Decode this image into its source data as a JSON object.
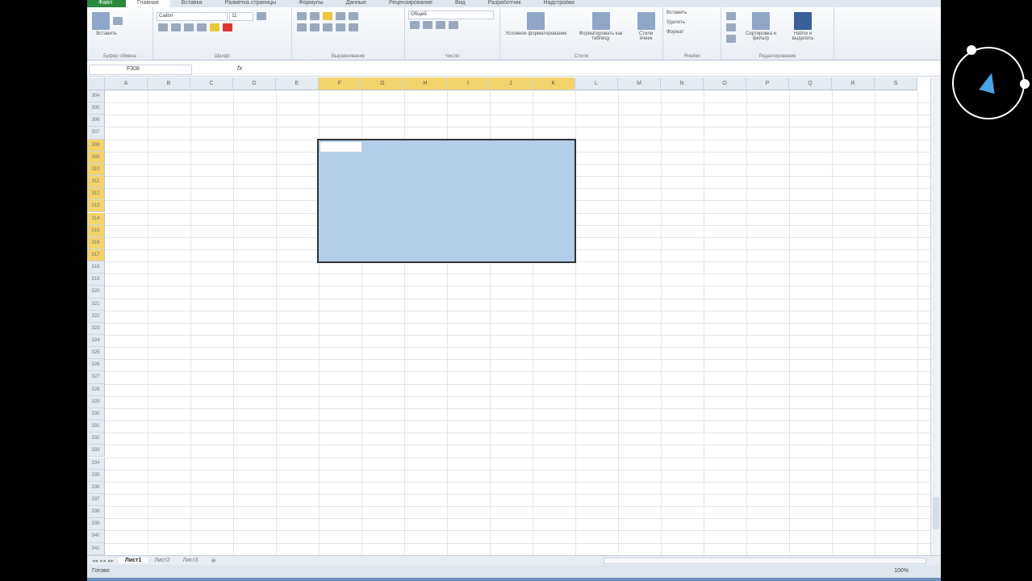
{
  "ribbon_tabs": [
    "Файл",
    "Главная",
    "Вставка",
    "Разметка страницы",
    "Формулы",
    "Данные",
    "Рецензирование",
    "Вид",
    "Разработчик",
    "Надстройки"
  ],
  "ribbon": {
    "clipboard": {
      "paste": "Вставить",
      "label": "Буфер обмена"
    },
    "font": {
      "name": "Calibri",
      "size": "11",
      "label": "Шрифт"
    },
    "alignment": {
      "label": "Выравнивание"
    },
    "number": {
      "format": "Общий",
      "label": "Число"
    },
    "styles": {
      "conditional": "Условное форматирование",
      "as_table": "Форматировать как таблицу",
      "cell_styles": "Стили ячеек",
      "label": "Стили"
    },
    "cells": {
      "insert": "Вставить",
      "delete": "Удалить",
      "format": "Формат",
      "label": "Ячейки"
    },
    "editing": {
      "sort": "Сортировка и фильтр",
      "find": "Найти и выделить",
      "label": "Редактирование"
    }
  },
  "formula_bar": {
    "name_box": "F308",
    "fx": "fx",
    "value": ""
  },
  "columns": [
    "A",
    "B",
    "C",
    "D",
    "E",
    "F",
    "G",
    "H",
    "I",
    "J",
    "K",
    "L",
    "M",
    "N",
    "O",
    "P",
    "Q",
    "R",
    "S"
  ],
  "selected_columns": [
    "F",
    "G",
    "H",
    "I",
    "J",
    "K"
  ],
  "first_row": 304,
  "last_row": 341,
  "selected_rows": [
    308,
    317
  ],
  "sheets": [
    "Лист1",
    "Лист2",
    "Лист3"
  ],
  "status": {
    "ready": "Готово",
    "zoom": "100%"
  },
  "colors": {
    "selection": "#b4cde9",
    "header_selected": "#f3d36b",
    "file_tab": "#2b8a3e"
  }
}
